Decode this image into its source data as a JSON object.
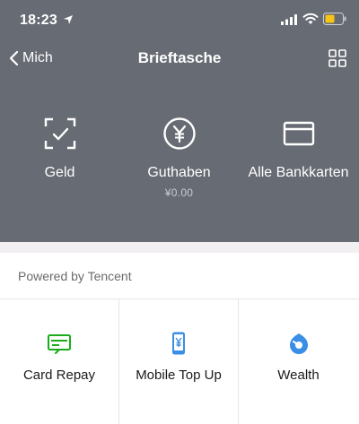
{
  "statusbar": {
    "time": "18:23"
  },
  "navbar": {
    "back_label": "Mich",
    "title": "Brieftasche"
  },
  "features": [
    {
      "label": "Geld",
      "icon": "scan-check-icon"
    },
    {
      "label": "Guthaben",
      "sub": "¥0.00",
      "icon": "yen-circle-icon"
    },
    {
      "label": "Alle Bankkarten",
      "icon": "bank-card-icon"
    }
  ],
  "section": {
    "label": "Powered by Tencent"
  },
  "services": [
    {
      "label": "Card Repay",
      "icon": "card-repay-icon",
      "color": "#1aad19"
    },
    {
      "label": "Mobile Top Up",
      "icon": "mobile-topup-icon",
      "color": "#3a8ee6"
    },
    {
      "label": "Wealth",
      "icon": "wealth-icon",
      "color": "#3a8ee6"
    }
  ],
  "colors": {
    "header_bg": "#676b73",
    "band_bg": "#f2eff2"
  }
}
